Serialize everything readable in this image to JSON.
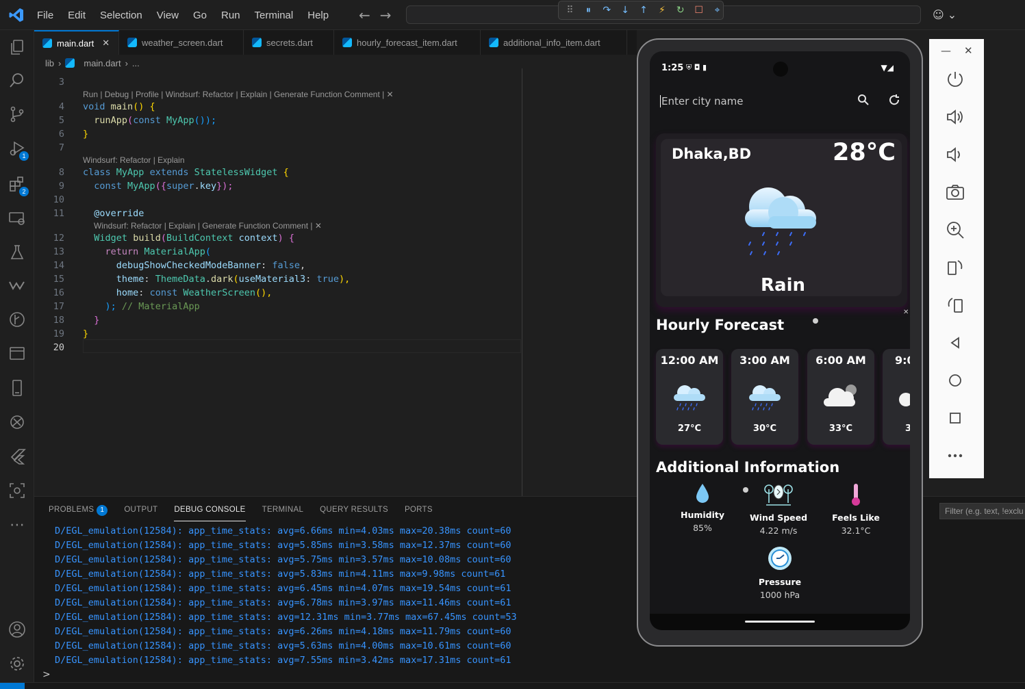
{
  "menu": [
    "File",
    "Edit",
    "Selection",
    "View",
    "Go",
    "Run",
    "Terminal",
    "Help"
  ],
  "tabs": [
    {
      "label": "main.dart",
      "active": true
    },
    {
      "label": "weather_screen.dart"
    },
    {
      "label": "secrets.dart"
    },
    {
      "label": "hourly_forecast_item.dart"
    },
    {
      "label": "additional_info_item.dart"
    }
  ],
  "breadcrumb": {
    "folder": "lib",
    "file": "main.dart",
    "more": "..."
  },
  "editor": {
    "lens_main": "Run | Debug | Profile | Windsurf: Refactor | Explain | Generate Function Comment | ✕",
    "lens_class": "Windsurf: Refactor | Explain",
    "lens_build": "Windsurf: Refactor | Explain | Generate Function Comment | ✕",
    "line_numbers": [
      "3",
      "4",
      "5",
      "6",
      "7",
      "8",
      "9",
      "10",
      "11",
      "12",
      "13",
      "14",
      "15",
      "16",
      "17",
      "18",
      "19",
      "20"
    ],
    "code": {
      "l4_a": "void",
      "l4_b": "main",
      "l4_c": "() {",
      "l5_a": "runApp",
      "l5_b": "(",
      "l5_c": "const",
      "l5_d": "MyApp",
      "l5_e": "());",
      "l6": "}",
      "l8_a": "class",
      "l8_b": "MyApp",
      "l8_c": "extends",
      "l8_d": "StatelessWidget",
      "l8_e": "{",
      "l9_a": "const",
      "l9_b": "MyApp",
      "l9_c": "({",
      "l9_d": "super",
      "l9_e": ".",
      "l9_f": "key",
      "l9_g": "});",
      "l11": "@override",
      "l12_a": "Widget",
      "l12_b": "build",
      "l12_c": "(",
      "l12_d": "BuildContext",
      "l12_e": "context",
      "l12_f": ") {",
      "l13_a": "return",
      "l13_b": "MaterialApp",
      "l13_c": "(",
      "l14_a": "debugShowCheckedModeBanner",
      "l14_b": ": ",
      "l14_c": "false",
      "l14_d": ",",
      "l15_a": "theme",
      "l15_b": ": ",
      "l15_c": "ThemeData",
      "l15_d": ".",
      "l15_e": "dark",
      "l15_f": "(",
      "l15_g": "useMaterial3",
      "l15_h": ": ",
      "l15_i": "true",
      "l15_j": "),",
      "l16_a": "home",
      "l16_b": ": ",
      "l16_c": "const",
      "l16_d": "WeatherScreen",
      "l16_e": "(),",
      "l17_a": ");",
      "l17_b": "// MaterialApp",
      "l18": "}",
      "l19": "}"
    }
  },
  "panel": {
    "tabs": [
      "PROBLEMS",
      "OUTPUT",
      "DEBUG CONSOLE",
      "TERMINAL",
      "QUERY RESULTS",
      "PORTS"
    ],
    "problems_count": "1",
    "active_tab": "DEBUG CONSOLE",
    "filter_placeholder": "Filter (e.g. text, !exclu",
    "log": [
      "D/EGL_emulation(12584): app_time_stats: avg=6.66ms min=4.03ms max=20.38ms count=60",
      "D/EGL_emulation(12584): app_time_stats: avg=5.85ms min=3.58ms max=12.37ms count=60",
      "D/EGL_emulation(12584): app_time_stats: avg=5.75ms min=3.57ms max=10.08ms count=60",
      "D/EGL_emulation(12584): app_time_stats: avg=5.83ms min=4.11ms max=9.98ms count=61",
      "D/EGL_emulation(12584): app_time_stats: avg=6.45ms min=4.07ms max=19.54ms count=61",
      "D/EGL_emulation(12584): app_time_stats: avg=6.78ms min=3.97ms max=11.46ms count=61",
      "D/EGL_emulation(12584): app_time_stats: avg=12.31ms min=3.77ms max=67.45ms count=53",
      "D/EGL_emulation(12584): app_time_stats: avg=6.26ms min=4.18ms max=11.79ms count=60",
      "D/EGL_emulation(12584): app_time_stats: avg=5.63ms min=4.00ms max=10.61ms count=60",
      "D/EGL_emulation(12584): app_time_stats: avg=7.55ms min=3.42ms max=17.31ms count=61"
    ],
    "prompt": ">"
  },
  "activity_badges": {
    "run_debug": "1",
    "extensions": "2"
  },
  "phone": {
    "status_time": "1:25",
    "search_placeholder": "Enter city name",
    "city": "Dhaka,BD",
    "temperature": "28°C",
    "condition": "Rain",
    "hourly_title": "Hourly Forecast",
    "hourly": [
      {
        "time": "12:00 AM",
        "temp": "27°C",
        "icon": "rain-cloud-icon"
      },
      {
        "time": "3:00 AM",
        "temp": "30°C",
        "icon": "rain-cloud-icon"
      },
      {
        "time": "6:00 AM",
        "temp": "33°C",
        "icon": "cloud-icon"
      },
      {
        "time": "9:0",
        "temp": "3",
        "icon": "cloud-icon"
      }
    ],
    "additional_title": "Additional Information",
    "info": [
      {
        "label": "Humidity",
        "value": "85%",
        "icon": "droplet-icon"
      },
      {
        "label": "Wind Speed",
        "value": "4.22 m/s",
        "icon": "wind-icon"
      },
      {
        "label": "Feels Like",
        "value": "32.1°C",
        "icon": "thermometer-icon"
      },
      {
        "label": "Pressure",
        "value": "1000 hPa",
        "icon": "gauge-icon"
      }
    ]
  },
  "emulator_controls": [
    "power-icon",
    "volume-up-icon",
    "volume-down-icon",
    "camera-icon",
    "zoom-icon",
    "rotate-left-icon",
    "rotate-right-icon",
    "back-icon",
    "home-icon",
    "overview-icon",
    "more-icon"
  ],
  "colors": {
    "accent": "#0078d4",
    "log": "#3794ff",
    "editor_bg": "#1f1f1f"
  }
}
